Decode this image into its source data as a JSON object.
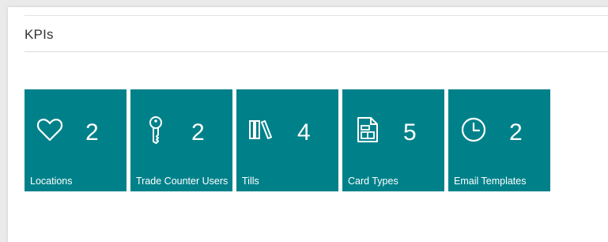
{
  "section": {
    "title": "KPIs"
  },
  "tiles": [
    {
      "label": "Locations",
      "value": "2",
      "icon": "heart-icon"
    },
    {
      "label": "Trade Counter Users",
      "value": "2",
      "icon": "key-icon"
    },
    {
      "label": "Tills",
      "value": "4",
      "icon": "library-books-icon"
    },
    {
      "label": "Card Types",
      "value": "5",
      "icon": "calculator-icon"
    },
    {
      "label": "Email Templates",
      "value": "2",
      "icon": "clock-icon"
    }
  ],
  "colors": {
    "tile_bg": "#00818a",
    "tile_fg": "#ffffff"
  }
}
